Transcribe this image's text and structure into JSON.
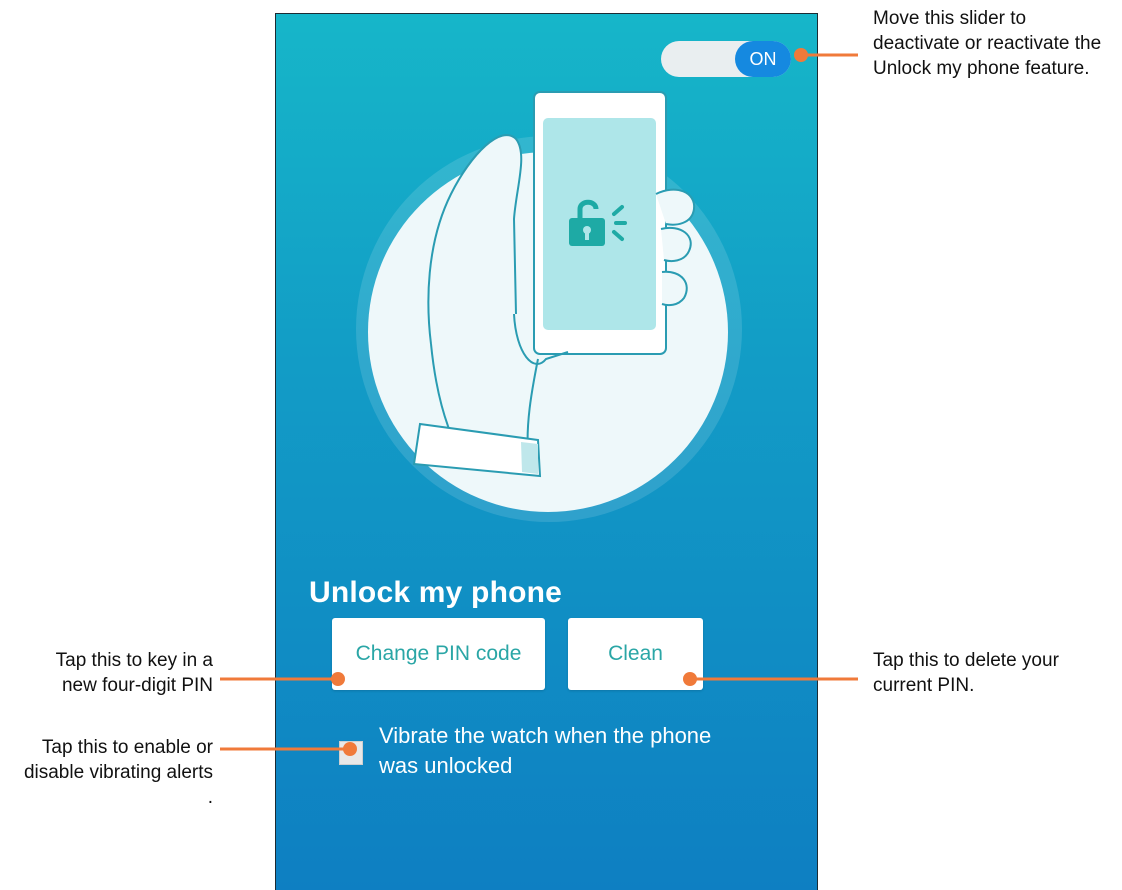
{
  "toggle": {
    "state_label": "ON"
  },
  "screen": {
    "title": "Unlock my phone",
    "buttons": {
      "change_pin": "Change PIN code",
      "clean": "Clean"
    },
    "vibrate_option": {
      "label": "Vibrate the watch when the phone was unlocked",
      "checked": false
    }
  },
  "callouts": {
    "toggle": "Move this slider to deactivate or reactivate the Unlock my phone feature.",
    "change_pin": "Tap this to key in a new four-digit PIN",
    "clean": "Tap this to delete your current PIN.",
    "vibrate": "Tap this to enable or disable vibrating alerts ."
  },
  "colors": {
    "gradient_top": "#16b6c9",
    "gradient_bottom": "#0e7fc2",
    "toggle_on": "#1589e0",
    "button_text": "#2aa6a6",
    "callout_line": "#f07a3a"
  },
  "icons": [
    "hand-holding-phone-illustration",
    "unlock-icon"
  ]
}
